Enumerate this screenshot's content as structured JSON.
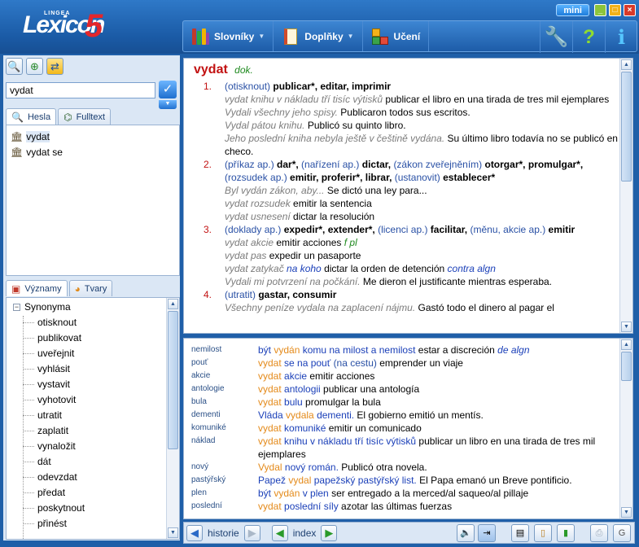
{
  "app": {
    "logo_small": "LINGEA",
    "logo_main": "Lexicon",
    "logo_num": "5",
    "mini_label": "mini",
    "window": {
      "minimize": "_",
      "maximize": "□",
      "close": "×"
    }
  },
  "menu": {
    "items": [
      {
        "label": "Slovníky",
        "icon": "books-icon"
      },
      {
        "label": "Doplňky",
        "icon": "notebook-icon"
      },
      {
        "label": "Učení",
        "icon": "blocks-icon"
      }
    ],
    "tools": [
      {
        "icon": "wrench-icon",
        "glyph": "🔧"
      },
      {
        "icon": "help-icon",
        "glyph": "?"
      },
      {
        "icon": "info-icon",
        "glyph": "i"
      }
    ]
  },
  "search": {
    "value": "vydat",
    "ok_glyph": "✓"
  },
  "tabs_top": [
    {
      "label": "Hesla",
      "icon": "search-icon",
      "active": true
    },
    {
      "label": "Fulltext",
      "icon": "binoculars-icon",
      "active": false
    }
  ],
  "hesla": [
    {
      "label": "vydat",
      "selected": true
    },
    {
      "label": "vydat se",
      "selected": false
    }
  ],
  "tabs_bottom": [
    {
      "label": "Významy",
      "active": true
    },
    {
      "label": "Tvary",
      "active": false
    }
  ],
  "synonyms": {
    "root": "Synonyma",
    "items": [
      "otisknout",
      "publikovat",
      "uveřejnit",
      "vyhlásit",
      "vystavit",
      "vyhotovit",
      "utratit",
      "zaplatit",
      "vynaložit",
      "dát",
      "odevzdat",
      "předat",
      "poskytnout",
      "přinést"
    ]
  },
  "entry": {
    "headword": "vydat",
    "tag": "dok.",
    "senses": [
      {
        "num": "1.",
        "lines": [
          [
            {
              "c": "ctx",
              "t": "(otisknout) "
            },
            {
              "c": "bold",
              "t": "publicar*, editar, imprimir"
            }
          ],
          [
            {
              "c": "ex",
              "t": "vydat knihu v nákladu tří tisíc výtisků"
            },
            {
              "c": "",
              "t": "  publicar el libro en una tirada de tres mil ejemplares"
            }
          ],
          [
            {
              "c": "ex",
              "t": "Vydali všechny jeho spisy."
            },
            {
              "c": "",
              "t": "  Publicaron todos sus escritos."
            }
          ],
          [
            {
              "c": "ex",
              "t": "Vydal pátou knihu."
            },
            {
              "c": "",
              "t": "  Publicó su quinto libro."
            }
          ],
          [
            {
              "c": "ex",
              "t": "Jeho poslední kniha nebyla ještě v češtině vydána."
            },
            {
              "c": "",
              "t": "  Su último libro todavía no se publicó en checo."
            }
          ]
        ]
      },
      {
        "num": "2.",
        "lines": [
          [
            {
              "c": "ctx",
              "t": "(příkaz ap.) "
            },
            {
              "c": "bold",
              "t": "dar*, "
            },
            {
              "c": "ctx",
              "t": "(nařízení ap.) "
            },
            {
              "c": "bold",
              "t": "dictar, "
            },
            {
              "c": "ctx",
              "t": "(zákon zveřejněním) "
            },
            {
              "c": "bold",
              "t": "otorgar*, promulgar*, "
            },
            {
              "c": "ctx",
              "t": "(rozsudek ap.) "
            },
            {
              "c": "bold",
              "t": "emitir, proferir*, librar, "
            },
            {
              "c": "ctx",
              "t": "(ustanovit) "
            },
            {
              "c": "bold",
              "t": "establecer*"
            }
          ],
          [
            {
              "c": "ex",
              "t": "Byl vydán zákon, aby..."
            },
            {
              "c": "",
              "t": "  Se dictó una ley para..."
            }
          ],
          [
            {
              "c": "ex",
              "t": "vydat rozsudek"
            },
            {
              "c": "",
              "t": "  emitir la sentencia"
            }
          ],
          [
            {
              "c": "ex",
              "t": "vydat usnesení"
            },
            {
              "c": "",
              "t": "  dictar la resolución"
            }
          ]
        ]
      },
      {
        "num": "3.",
        "lines": [
          [
            {
              "c": "ctx",
              "t": "(doklady ap.) "
            },
            {
              "c": "bold",
              "t": "expedir*, extender*, "
            },
            {
              "c": "ctx",
              "t": "(licenci ap.) "
            },
            {
              "c": "bold",
              "t": "facilitar, "
            },
            {
              "c": "ctx",
              "t": "(měnu, akcie ap.) "
            },
            {
              "c": "bold",
              "t": "emitir"
            }
          ],
          [
            {
              "c": "ex",
              "t": "vydat akcie"
            },
            {
              "c": "",
              "t": "  emitir acciones "
            },
            {
              "c": "gr",
              "t": "f pl"
            }
          ],
          [
            {
              "c": "ex",
              "t": "vydat pas"
            },
            {
              "c": "",
              "t": "  expedir un pasaporte"
            }
          ],
          [
            {
              "c": "ex",
              "t": "vydat zatykač "
            },
            {
              "c": "bl",
              "t": "na koho"
            },
            {
              "c": "",
              "t": "  dictar la orden de detención "
            },
            {
              "c": "bl",
              "t": "contra algn"
            }
          ],
          [
            {
              "c": "ex",
              "t": "Vydali mi potvrzení na počkání."
            },
            {
              "c": "",
              "t": "  Me dieron el justificante mientras esperaba."
            }
          ]
        ]
      },
      {
        "num": "4.",
        "lines": [
          [
            {
              "c": "ctx",
              "t": "(utratit) "
            },
            {
              "c": "bold",
              "t": "gastar, consumir"
            }
          ],
          [
            {
              "c": "ex",
              "t": "Všechny peníze vydala na zaplacení nájmu."
            },
            {
              "c": "",
              "t": "  Gastó todo el dinero al pagar el"
            }
          ]
        ]
      }
    ]
  },
  "collocations": [
    {
      "key": "nemilost",
      "val": [
        {
          "c": "db",
          "t": "být "
        },
        {
          "c": "or",
          "t": "vydán "
        },
        {
          "c": "db",
          "t": "komu"
        },
        {
          "c": "db",
          "t": " na milost a nemilost"
        },
        {
          "c": "",
          "t": "  estar a discreción "
        },
        {
          "c": "bl",
          "t": "de algn"
        }
      ]
    },
    {
      "key": "pouť",
      "val": [
        {
          "c": "or",
          "t": "vydat "
        },
        {
          "c": "db",
          "t": "se na pouť "
        },
        {
          "c": "ctx",
          "t": "(na cestu)"
        },
        {
          "c": "",
          "t": "  emprender un viaje"
        }
      ]
    },
    {
      "key": "akcie",
      "val": [
        {
          "c": "or",
          "t": "vydat "
        },
        {
          "c": "db",
          "t": "akcie"
        },
        {
          "c": "",
          "t": "  emitir acciones"
        }
      ]
    },
    {
      "key": "antologie",
      "val": [
        {
          "c": "or",
          "t": "vydat "
        },
        {
          "c": "db",
          "t": "antologii"
        },
        {
          "c": "",
          "t": "  publicar una antología"
        }
      ]
    },
    {
      "key": "bula",
      "val": [
        {
          "c": "or",
          "t": "vydat "
        },
        {
          "c": "db",
          "t": "bulu"
        },
        {
          "c": "",
          "t": "  promulgar la bula"
        }
      ]
    },
    {
      "key": "dementi",
      "val": [
        {
          "c": "db",
          "t": "Vláda "
        },
        {
          "c": "or",
          "t": "vydala "
        },
        {
          "c": "db",
          "t": "dementi."
        },
        {
          "c": "",
          "t": "  El gobierno emitió un mentís."
        }
      ]
    },
    {
      "key": "komuniké",
      "val": [
        {
          "c": "or",
          "t": "vydat "
        },
        {
          "c": "db",
          "t": "komuniké"
        },
        {
          "c": "",
          "t": "  emitir un comunicado"
        }
      ]
    },
    {
      "key": "náklad",
      "val": [
        {
          "c": "or",
          "t": "vydat "
        },
        {
          "c": "db",
          "t": "knihu v nákladu tří tisíc výtisků"
        },
        {
          "c": "",
          "t": "  publicar un libro en una tirada de tres mil ejemplares"
        }
      ]
    },
    {
      "key": "nový",
      "val": [
        {
          "c": "or",
          "t": "Vydal "
        },
        {
          "c": "db",
          "t": "nový román."
        },
        {
          "c": "",
          "t": "  Publicó otra novela."
        }
      ]
    },
    {
      "key": "pastýřský",
      "val": [
        {
          "c": "db",
          "t": "Papež "
        },
        {
          "c": "or",
          "t": "vydal "
        },
        {
          "c": "db",
          "t": "papežský pastýřský list."
        },
        {
          "c": "",
          "t": "  El Papa emanó un Breve pontificio."
        }
      ]
    },
    {
      "key": "plen",
      "val": [
        {
          "c": "db",
          "t": "být "
        },
        {
          "c": "or",
          "t": "vydán "
        },
        {
          "c": "db",
          "t": "v plen"
        },
        {
          "c": "",
          "t": "  ser entregado a la merced/al saqueo/al pillaje"
        }
      ]
    },
    {
      "key": "poslední",
      "val": [
        {
          "c": "or",
          "t": "vydat "
        },
        {
          "c": "db",
          "t": "poslední síly"
        },
        {
          "c": "",
          "t": "  azotar las últimas fuerzas"
        }
      ]
    }
  ],
  "bottom": {
    "history": "historie",
    "index": "index"
  },
  "colors": {
    "accent": "#1f5fa8",
    "headword": "#c21212",
    "context": "#2950a5",
    "example": "#7c7c7c",
    "verb": "#e48a1a"
  }
}
